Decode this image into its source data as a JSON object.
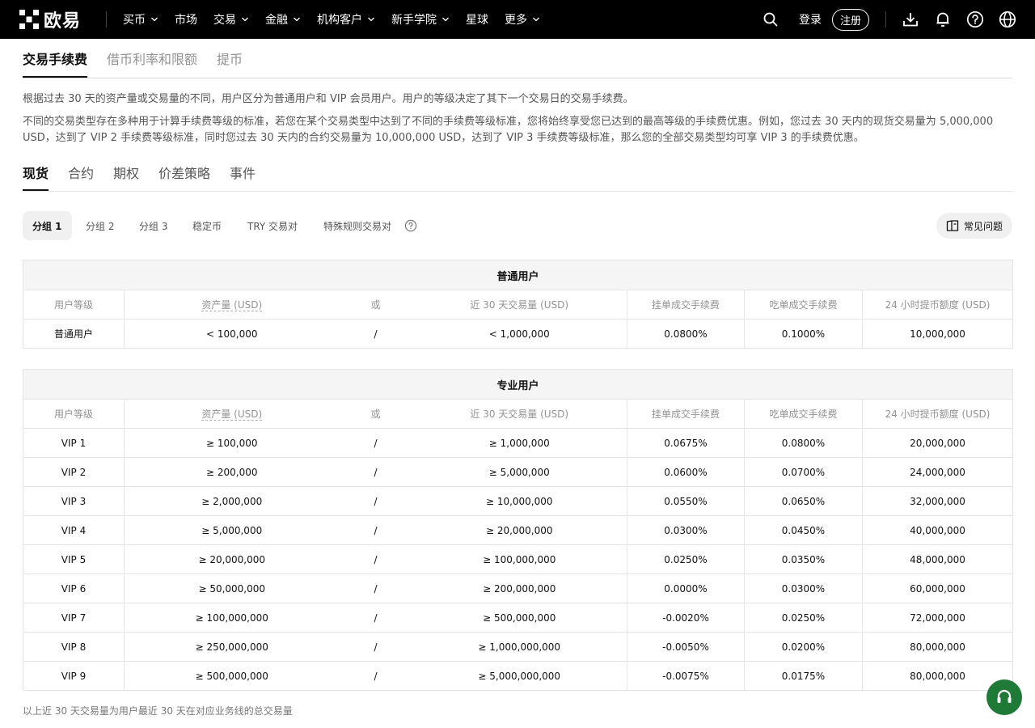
{
  "nav": {
    "logo_text": "欧易",
    "items": [
      {
        "label": "买币",
        "has_menu": true
      },
      {
        "label": "市场",
        "has_menu": false
      },
      {
        "label": "交易",
        "has_menu": true
      },
      {
        "label": "金融",
        "has_menu": true
      },
      {
        "label": "机构客户",
        "has_menu": true
      },
      {
        "label": "新手学院",
        "has_menu": true
      },
      {
        "label": "星球",
        "has_menu": false
      },
      {
        "label": "更多",
        "has_menu": true
      }
    ],
    "login": "登录",
    "register": "注册"
  },
  "page_tabs": [
    "交易手续费",
    "借币利率和限额",
    "提币"
  ],
  "description": {
    "line1": "根据过去 30 天的资产量或交易量的不同，用户区分为普通用户和 VIP 会员用户。用户的等级决定了其下一个交易日的交易手续费。",
    "line2": "不同的交易类型存在多种用于计算手续费等级的标准，若您在某个交易类型中达到了不同的手续费等级标准，您将始终享受您已达到的最高等级的手续费优惠。例如，您过去 30 天内的现货交易量为 5,000,000 USD，达到了 VIP 2 手续费等级标准，同时您过去 30 天内的合约交易量为 10,000,000 USD，达到了 VIP 3 手续费等级标准，那么您的全部交易类型均可享 VIP 3 的手续费优惠。"
  },
  "product_tabs": [
    "现货",
    "合约",
    "期权",
    "价差策略",
    "事件"
  ],
  "groups": [
    "分组 1",
    "分组 2",
    "分组 3",
    "稳定币",
    "TRY 交易对",
    "特殊规则交易对"
  ],
  "faq_label": "常见问题",
  "columns": {
    "level": "用户等级",
    "assets": "资产量 (USD)",
    "or": "或",
    "volume": "近 30 天交易量 (USD)",
    "maker": "挂单成交手续费",
    "taker": "吃单成交手续费",
    "withdraw": "24 小时提币额度 (USD)"
  },
  "regular": {
    "title": "普通用户",
    "rows": [
      {
        "level": "普通用户",
        "assets": "< 100,000",
        "sep": "/",
        "volume": "< 1,000,000",
        "maker": "0.0800%",
        "taker": "0.1000%",
        "withdraw": "10,000,000"
      }
    ]
  },
  "pro": {
    "title": "专业用户",
    "rows": [
      {
        "level": "VIP 1",
        "assets": "≥ 100,000",
        "sep": "/",
        "volume": "≥ 1,000,000",
        "maker": "0.0675%",
        "taker": "0.0800%",
        "withdraw": "20,000,000"
      },
      {
        "level": "VIP 2",
        "assets": "≥ 200,000",
        "sep": "/",
        "volume": "≥ 5,000,000",
        "maker": "0.0600%",
        "taker": "0.0700%",
        "withdraw": "24,000,000"
      },
      {
        "level": "VIP 3",
        "assets": "≥ 2,000,000",
        "sep": "/",
        "volume": "≥ 10,000,000",
        "maker": "0.0550%",
        "taker": "0.0650%",
        "withdraw": "32,000,000"
      },
      {
        "level": "VIP 4",
        "assets": "≥ 5,000,000",
        "sep": "/",
        "volume": "≥ 20,000,000",
        "maker": "0.0300%",
        "taker": "0.0450%",
        "withdraw": "40,000,000"
      },
      {
        "level": "VIP 5",
        "assets": "≥ 20,000,000",
        "sep": "/",
        "volume": "≥ 100,000,000",
        "maker": "0.0250%",
        "taker": "0.0350%",
        "withdraw": "48,000,000"
      },
      {
        "level": "VIP 6",
        "assets": "≥ 50,000,000",
        "sep": "/",
        "volume": "≥ 200,000,000",
        "maker": "0.0000%",
        "taker": "0.0300%",
        "withdraw": "60,000,000"
      },
      {
        "level": "VIP 7",
        "assets": "≥ 100,000,000",
        "sep": "/",
        "volume": "≥ 500,000,000",
        "maker": "-0.0020%",
        "taker": "0.0250%",
        "withdraw": "72,000,000"
      },
      {
        "level": "VIP 8",
        "assets": "≥ 250,000,000",
        "sep": "/",
        "volume": "≥ 1,000,000,000",
        "maker": "-0.0050%",
        "taker": "0.0200%",
        "withdraw": "80,000,000"
      },
      {
        "level": "VIP 9",
        "assets": "≥ 500,000,000",
        "sep": "/",
        "volume": "≥ 5,000,000,000",
        "maker": "-0.0075%",
        "taker": "0.0175%",
        "withdraw": "80,000,000"
      }
    ]
  },
  "footnote": "以上近 30 天交易量为用户最近 30 天在对应业务线的总交易量",
  "icons": {
    "search": "search-icon",
    "download": "download-icon",
    "bell": "bell-icon",
    "help": "help-icon",
    "globe": "globe-icon",
    "info": "info-icon",
    "faq": "book-icon",
    "support": "headset-icon"
  },
  "colors": {
    "nav_bg": "#000000",
    "support_bg": "#1f7a38",
    "muted_text": "#929292"
  }
}
